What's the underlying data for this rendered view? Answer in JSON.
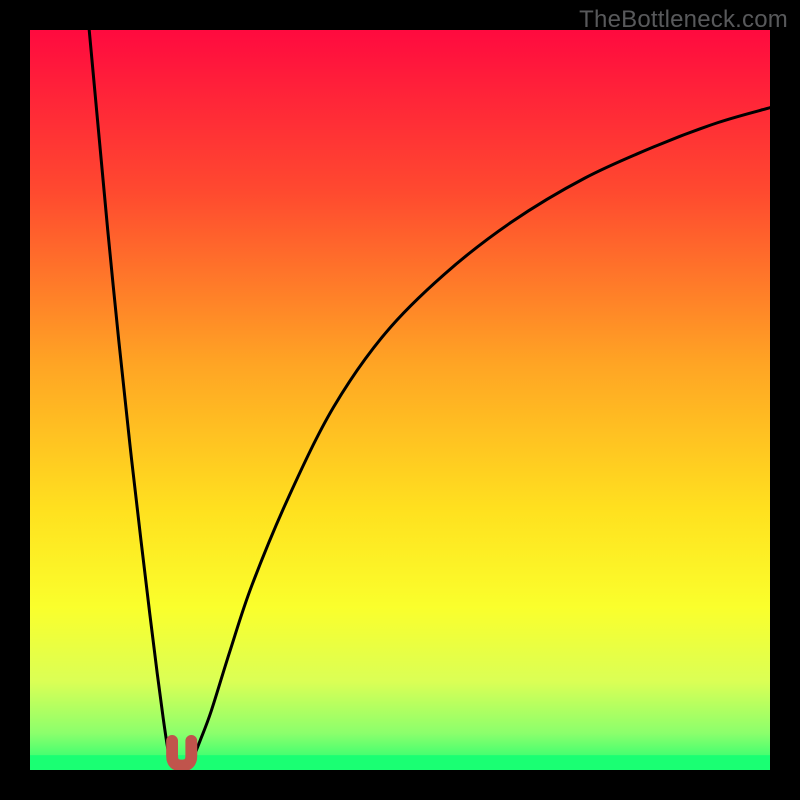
{
  "watermark": "TheBottleneck.com",
  "chart_data": {
    "type": "line",
    "title": "",
    "xlabel": "",
    "ylabel": "",
    "xlim": [
      0,
      100
    ],
    "ylim": [
      0,
      100
    ],
    "grid": false,
    "legend": false,
    "annotations": [],
    "background_gradient_stops": [
      {
        "pos": 0.0,
        "color": "#ff0a3f"
      },
      {
        "pos": 0.22,
        "color": "#ff4a2f"
      },
      {
        "pos": 0.45,
        "color": "#ffa424"
      },
      {
        "pos": 0.65,
        "color": "#ffe11f"
      },
      {
        "pos": 0.78,
        "color": "#faff2c"
      },
      {
        "pos": 0.88,
        "color": "#dbff55"
      },
      {
        "pos": 0.95,
        "color": "#8cff6c"
      },
      {
        "pos": 1.0,
        "color": "#1aff73"
      }
    ],
    "bottom_green_band": {
      "fraction_of_height": 0.02
    },
    "series": [
      {
        "name": "left-branch",
        "x": [
          8.0,
          9.2,
          10.5,
          12.0,
          13.5,
          15.0,
          16.2,
          17.2,
          18.0,
          18.6,
          19.0
        ],
        "y": [
          100,
          87,
          73,
          58,
          44,
          31,
          21,
          13,
          7,
          3,
          1.5
        ]
      },
      {
        "name": "right-branch",
        "x": [
          22.0,
          23.0,
          24.5,
          27.0,
          30.0,
          35.0,
          41.0,
          48.0,
          56.0,
          65.0,
          75.0,
          85.0,
          93.0,
          100.0
        ],
        "y": [
          1.5,
          4.0,
          8.0,
          16.0,
          25.0,
          37.0,
          49.0,
          59.0,
          67.0,
          74.0,
          80.0,
          84.5,
          87.5,
          89.5
        ]
      }
    ],
    "trough_marker": {
      "shape": "notch",
      "color": "#c0544c",
      "center_x": 20.5,
      "inner_width": 2.6,
      "stroke_width": 1.6,
      "depth_from_bottom": 3.5
    }
  }
}
